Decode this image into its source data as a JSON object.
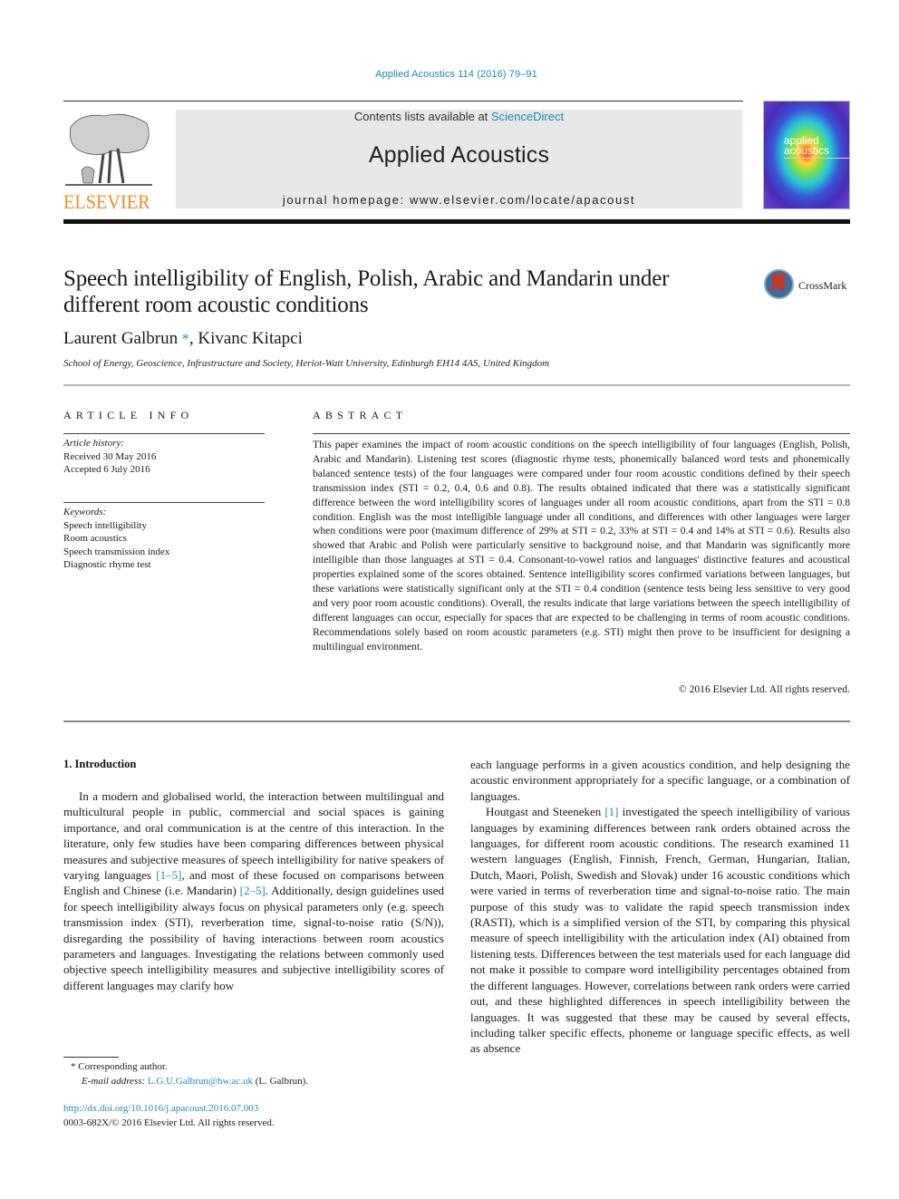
{
  "header": {
    "citation": "Applied Acoustics 114 (2016) 79–91",
    "contents_prefix": "Contents lists available at ",
    "contents_link": "ScienceDirect",
    "journal_name": "Applied Acoustics",
    "homepage_prefix": "journal homepage: ",
    "homepage_url": "www.elsevier.com/locate/apacoust",
    "publisher_logo_text": "ELSEVIER",
    "cover_title_line1": "applied",
    "cover_title_line2": "acoustics",
    "crossmark_label": "CrossMark"
  },
  "article": {
    "title": "Speech intelligibility of English, Polish, Arabic and Mandarin under different room acoustic conditions",
    "authors": [
      {
        "name": "Laurent Galbrun",
        "marker": "*"
      },
      {
        "name": "Kivanc Kitapci",
        "marker": ""
      }
    ],
    "author_separator": ", ",
    "affiliation": "School of Energy, Geoscience, Infrastructure and Society, Heriot-Watt University, Edinburgh EH14 4AS, United Kingdom"
  },
  "article_info": {
    "label": "ARTICLE INFO",
    "history_label": "Article history:",
    "received": "Received 30 May 2016",
    "accepted": "Accepted 6 July 2016",
    "keywords_label": "Keywords:",
    "keywords": [
      "Speech intelligibility",
      "Room acoustics",
      "Speech transmission index",
      "Diagnostic rhyme test"
    ]
  },
  "abstract": {
    "label": "ABSTRACT",
    "text": "This paper examines the impact of room acoustic conditions on the speech intelligibility of four languages (English, Polish, Arabic and Mandarin). Listening test scores (diagnostic rhyme tests, phonemically balanced word tests and phonemically balanced sentence tests) of the four languages were compared under four room acoustic conditions defined by their speech transmission index (STI = 0.2, 0.4, 0.6 and 0.8). The results obtained indicated that there was a statistically significant difference between the word intelligibility scores of languages under all room acoustic conditions, apart from the STI = 0.8 condition. English was the most intelligible language under all conditions, and differences with other languages were larger when conditions were poor (maximum difference of 29% at STI = 0.2, 33% at STI = 0.4 and 14% at STI = 0.6). Results also showed that Arabic and Polish were particularly sensitive to background noise, and that Mandarin was significantly more intelligible than those languages at STI = 0.4. Consonant-to-vowel ratios and languages' distinctive features and acoustical properties explained some of the scores obtained. Sentence intelligibility scores confirmed variations between languages, but these variations were statistically significant only at the STI = 0.4 condition (sentence tests being less sensitive to very good and very poor room acoustic conditions). Overall, the results indicate that large variations between the speech intelligibility of different languages can occur, especially for spaces that are expected to be challenging in terms of room acoustic conditions. Recommendations solely based on room acoustic parameters (e.g. STI) might then prove to be insufficient for designing a multilingual environment.",
    "copyright": "© 2016 Elsevier Ltd. All rights reserved."
  },
  "body": {
    "section_heading": "1. Introduction",
    "left_col": {
      "p1_a": "In a modern and globalised world, the interaction between multilingual and multicultural people in public, commercial and social spaces is gaining importance, and oral communication is at the centre of this interaction. In the literature, only few studies have been comparing differences between physical measures and subjective measures of speech intelligibility for native speakers of varying languages ",
      "p1_ref1": "[1–5]",
      "p1_b": ", and most of these focused on comparisons between English and Chinese (i.e. Mandarin) ",
      "p1_ref2": "[2–5]",
      "p1_c": ". Additionally, design guidelines used for speech intelligibility always focus on physical parameters only (e.g. speech transmission index (STI), reverberation time, signal-to-noise ratio (S/N)), disregarding the possibility of having interactions between room acoustics parameters and languages. Investigating the relations between commonly used objective speech intelligibility measures and subjective intelligibility scores of different languages may clarify how"
    },
    "right_col": {
      "p1_cont": "each language performs in a given acoustics condition, and help designing the acoustic environment appropriately for a specific language, or a combination of languages.",
      "p2_a": "Houtgast and Steeneken ",
      "p2_ref": "[1]",
      "p2_b": " investigated the speech intelligibility of various languages by examining differences between rank orders obtained across the languages, for different room acoustic conditions. The research examined 11 western languages (English, Finnish, French, German, Hungarian, Italian, Dutch, Maori, Polish, Swedish and Slovak) under 16 acoustic conditions which were varied in terms of reverberation time and signal-to-noise ratio. The main purpose of this study was to validate the rapid speech transmission index (RASTI), which is a simplified version of the STI, by comparing this physical measure of speech intelligibility with the articulation index (AI) obtained from listening tests. Differences between the test materials used for each language did not make it possible to compare word intelligibility percentages obtained from the different languages. However, correlations between rank orders were carried out, and these highlighted differences in speech intelligibility between the languages. It was suggested that these may be caused by several effects, including talker specific effects, phoneme or language specific effects, as well as absence"
    }
  },
  "footnote": {
    "marker": "*",
    "corresponding": "Corresponding author.",
    "email_label": "E-mail address: ",
    "email": "L.G.U.Galbrun@hw.ac.uk",
    "email_suffix": " (L. Galbrun).",
    "doi": "http://dx.doi.org/10.1016/j.apacoust.2016.07.003",
    "issn": "0003-682X/© 2016 Elsevier Ltd. All rights reserved."
  },
  "colors": {
    "link": "#1f8ab3",
    "elsevier_orange": "#f28c28",
    "masthead_bg": "#e8e8e8"
  }
}
